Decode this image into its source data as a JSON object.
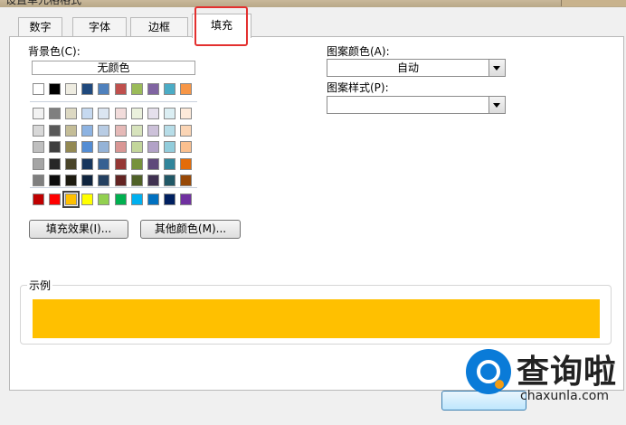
{
  "window": {
    "title": "设置单元格格式"
  },
  "tabs": [
    {
      "label": "数字"
    },
    {
      "label": "字体"
    },
    {
      "label": "边框"
    },
    {
      "label": "填充",
      "active": true
    }
  ],
  "fill": {
    "background_label": "背景色(C):",
    "no_color_label": "无颜色",
    "basic_colors": [
      "#ffffff",
      "#000000",
      "#eeece1",
      "#1f497d",
      "#4f81bd",
      "#c0504d",
      "#9bbb59",
      "#8064a2",
      "#4bacc6",
      "#f79646"
    ],
    "theme_shades": [
      [
        "#f2f2f2",
        "#7f7f7f",
        "#ddd9c3",
        "#c6d9f0",
        "#dbe5f1",
        "#f2dcdb",
        "#ebf1dd",
        "#e5e0ec",
        "#dbeef3",
        "#fdeada"
      ],
      [
        "#d8d8d8",
        "#595959",
        "#c4bd97",
        "#8db3e2",
        "#b8cce4",
        "#e5b9b7",
        "#d7e3bc",
        "#ccc1d9",
        "#b7dde8",
        "#fbd5b5"
      ],
      [
        "#bfbfbf",
        "#3f3f3f",
        "#938953",
        "#548dd4",
        "#95b3d7",
        "#d99694",
        "#c3d69b",
        "#b2a2c7",
        "#92cddc",
        "#fac08f"
      ],
      [
        "#a5a5a5",
        "#262626",
        "#494429",
        "#17365d",
        "#366092",
        "#953734",
        "#76923c",
        "#5f497a",
        "#31859b",
        "#e36c09"
      ],
      [
        "#7f7f7f",
        "#0c0c0c",
        "#1d1b10",
        "#0f243e",
        "#244061",
        "#632423",
        "#4f6128",
        "#3f3151",
        "#205867",
        "#974806"
      ]
    ],
    "standard_colors": [
      "#c00000",
      "#ff0000",
      "#ffc000",
      "#ffff00",
      "#92d050",
      "#00b050",
      "#00b0f0",
      "#0070c0",
      "#002060",
      "#7030a0"
    ],
    "selected_color": "#ffc000",
    "fill_effects_button": "填充效果(I)...",
    "more_colors_button": "其他颜色(M)...",
    "pattern_color_label": "图案颜色(A):",
    "pattern_color_value": "自动",
    "pattern_style_label": "图案样式(P):",
    "pattern_style_value": "",
    "sample_label": "示例"
  },
  "watermark": {
    "name": "查询啦",
    "url": "chaxunla.com"
  },
  "colors": {
    "highlight": "#e3302f",
    "sample_fill": "#ffc000"
  }
}
